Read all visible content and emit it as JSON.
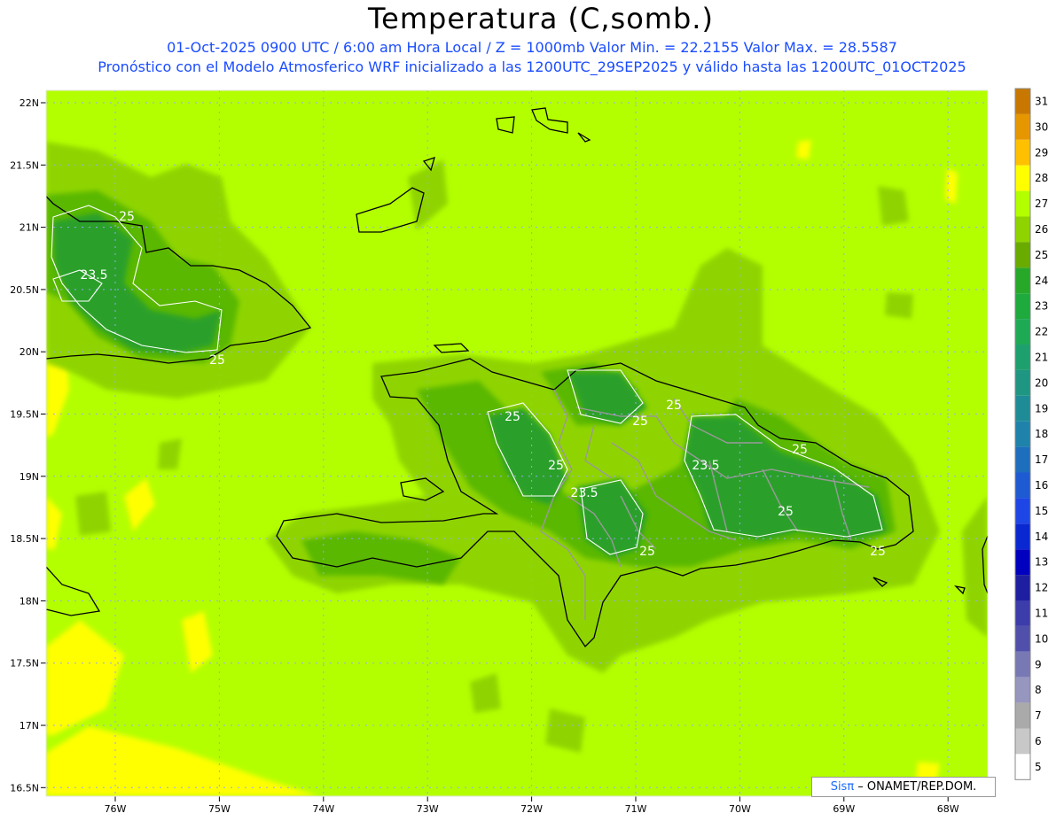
{
  "header": {
    "title": "Temperatura (C,somb.)",
    "subtitle_line1": "01-Oct-2025  0900 UTC / 6:00 am Hora Local / Z = 1000mb   Valor Min. = 22.2155  Valor Max. = 28.5587",
    "subtitle_line2": "Pronóstico con el Modelo Atmosferico WRF inicializado a las 1200UTC_29SEP2025 y válido hasta las  1200UTC_01OCT2025"
  },
  "map": {
    "lat_labels": [
      "22N",
      "21.5N",
      "21N",
      "20.5N",
      "20N",
      "19.5N",
      "19N",
      "18.5N",
      "18N",
      "17.5N",
      "17N",
      "16.5N"
    ],
    "lon_labels": [
      "76W",
      "75W",
      "74W",
      "73W",
      "72W",
      "71W",
      "70W",
      "69W",
      "68W"
    ],
    "contour_labels": [
      "25",
      "23.5",
      "25",
      "25",
      "25",
      "23.5",
      "25",
      "25",
      "23.5",
      "25",
      "25",
      "25",
      "25"
    ],
    "colors": {
      "base": "#b3ff00",
      "warm_patch": "#ffff00",
      "land_25": "#8fd400",
      "land_24": "#5ab800",
      "land_23": "#2aa02a",
      "grid": "#9aa4ff"
    }
  },
  "colorbar": {
    "labels": [
      "31",
      "30",
      "29",
      "28",
      "27",
      "26",
      "25",
      "24",
      "23",
      "22",
      "21",
      "20",
      "19",
      "18",
      "17",
      "16",
      "15",
      "14",
      "13",
      "12",
      "11",
      "10",
      "9",
      "8",
      "7",
      "6",
      "5"
    ],
    "colors": [
      "#c87800",
      "#e69600",
      "#ffc000",
      "#ffff00",
      "#b3ff00",
      "#8fd400",
      "#6aab00",
      "#28a828",
      "#1eaa3c",
      "#1eaa55",
      "#1ea06e",
      "#1e9682",
      "#1e8c96",
      "#1e82aa",
      "#1e6ebe",
      "#1e5ad2",
      "#1e46e6",
      "#0a28d2",
      "#0000be",
      "#1e1ea0",
      "#3c3caa",
      "#5050aa",
      "#7878b4",
      "#9696be",
      "#aaaaaa",
      "#c8c8c8",
      "#ffffff"
    ]
  },
  "credit": {
    "brand": "Sisπ",
    "text": " – ONAMET/REP.DOM."
  }
}
